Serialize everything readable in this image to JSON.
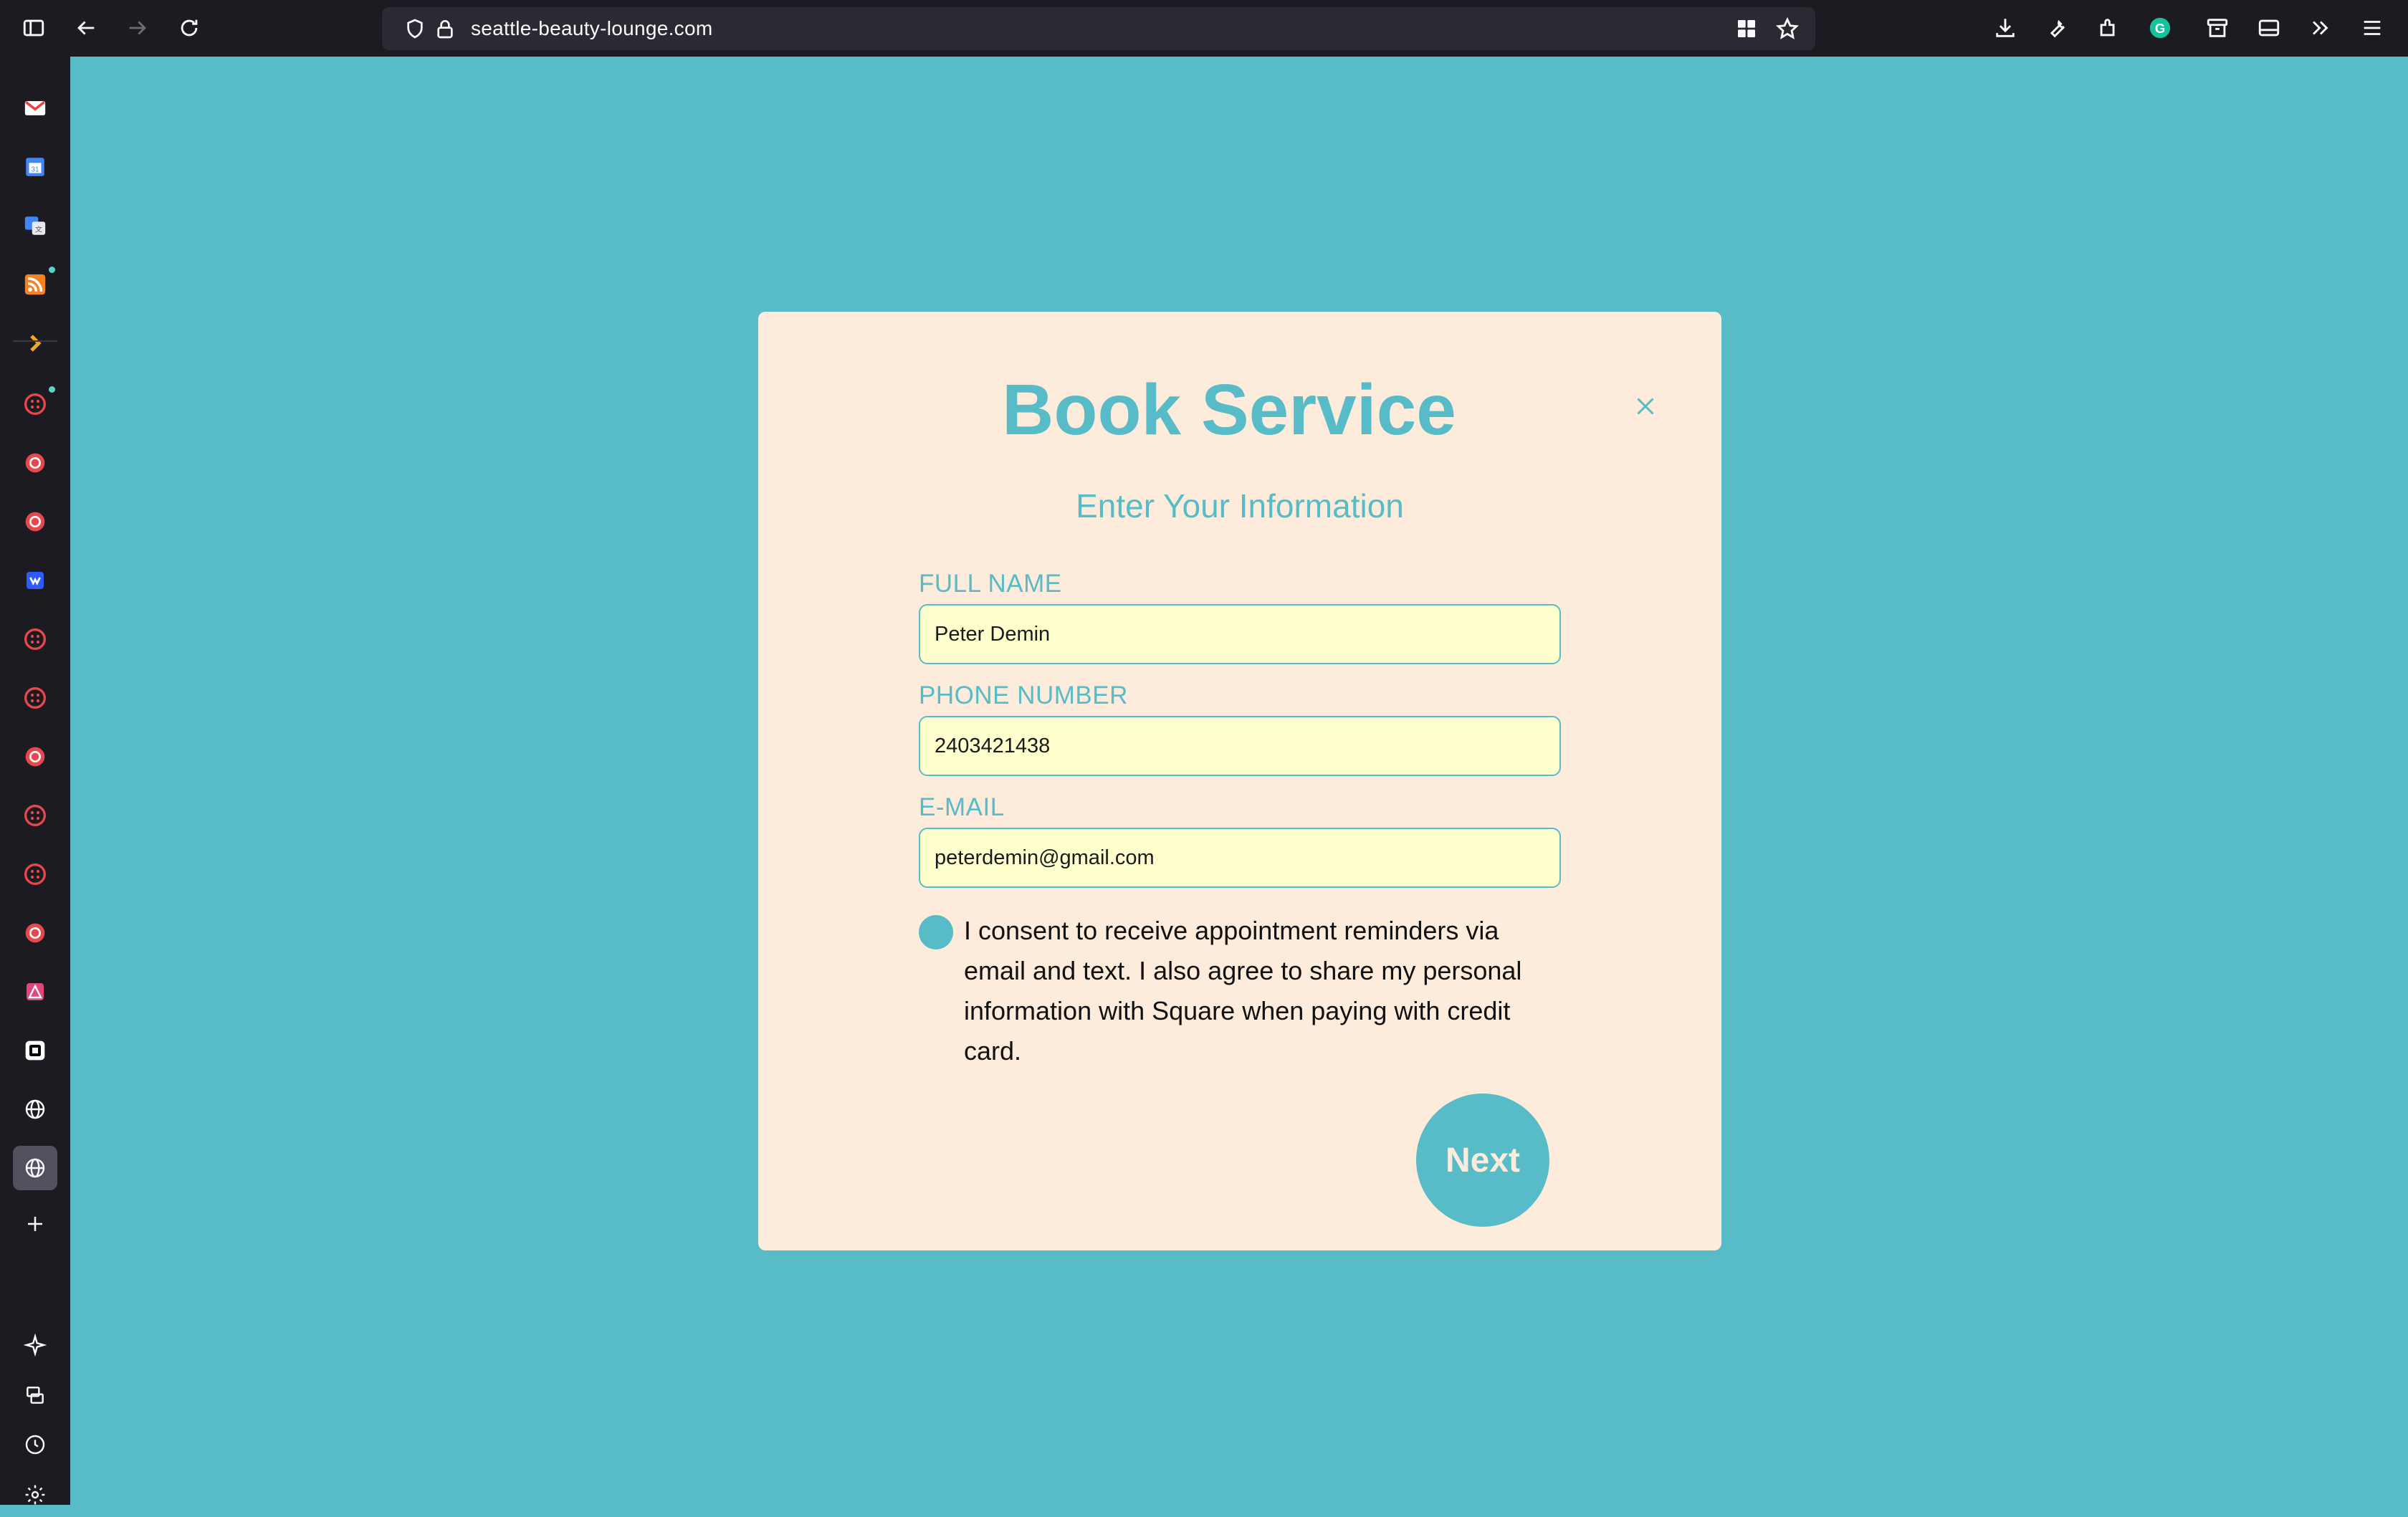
{
  "browser": {
    "url": "seattle-beauty-lounge.com"
  },
  "modal": {
    "title": "Book Service",
    "subtitle": "Enter Your Information",
    "close_icon": "close-icon",
    "fields": {
      "full_name": {
        "label": "FULL NAME",
        "value": "Peter Demin"
      },
      "phone": {
        "label": "PHONE NUMBER",
        "value": "2403421438"
      },
      "email": {
        "label": "E-MAIL",
        "value": "peterdemin@gmail.com"
      }
    },
    "consent_text": "I consent to receive appointment reminders via email and text. I also agree to share my personal information with Square when paying with credit card.",
    "next_label": "Next"
  },
  "colors": {
    "accent": "#57bcc7",
    "modal_bg": "#fdebdb",
    "input_bg": "#ffffcd",
    "browser_chrome": "#1c1b22"
  }
}
